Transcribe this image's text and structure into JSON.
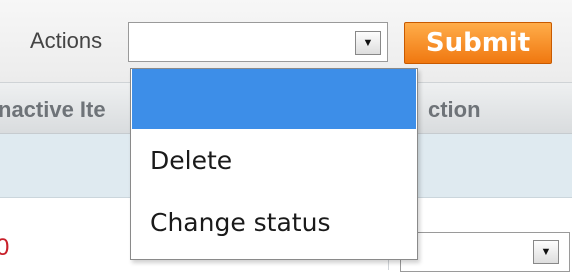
{
  "toolbar": {
    "actions_label": "Actions",
    "select_value": "",
    "submit_label": "Submit"
  },
  "grid": {
    "header_left": "nactive Ite",
    "header_right": "ction",
    "row_value": "0"
  },
  "dropdown": {
    "options": [
      {
        "label": "",
        "selected": true
      },
      {
        "label": "Delete",
        "selected": false
      },
      {
        "label": "Change status",
        "selected": false
      }
    ]
  },
  "icons": {
    "select_arrow": "chevron-down-icon"
  },
  "colors": {
    "submit": "#f07810",
    "selected_option": "#3d8ee8",
    "row_value": "#c8202a"
  }
}
